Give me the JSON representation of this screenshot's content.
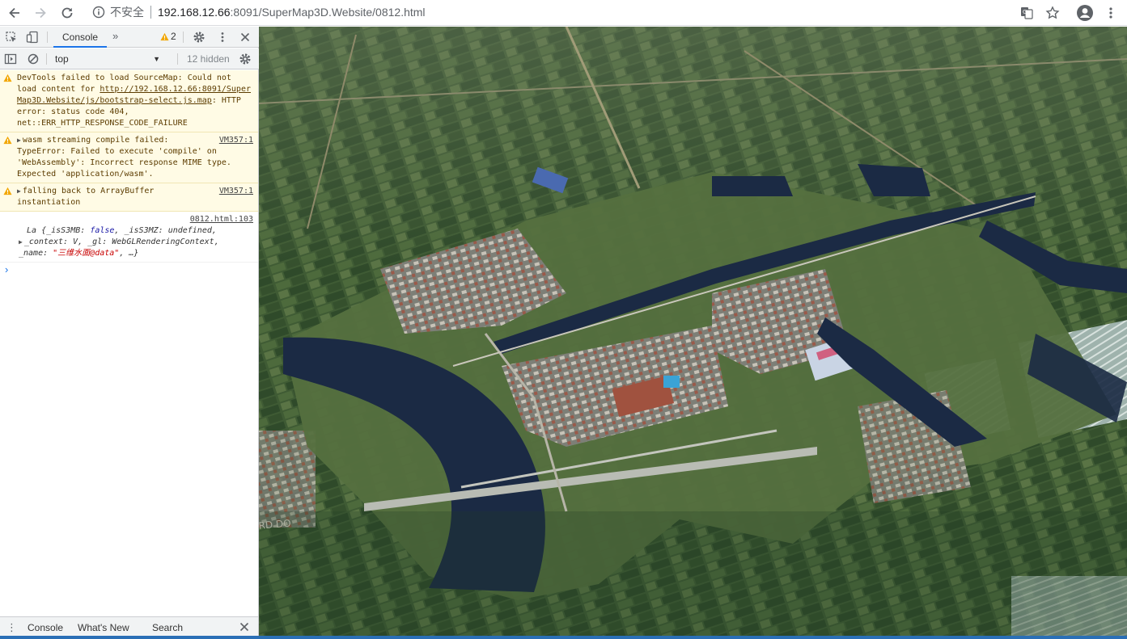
{
  "browser": {
    "security_label": "不安全",
    "url_host": "192.168.12.66",
    "url_path": ":8091/SuperMap3D.Website/0812.html"
  },
  "devtools": {
    "tab_console": "Console",
    "warning_count": "2",
    "context": "top",
    "hidden": "12 hidden",
    "messages": [
      {
        "level": "warning",
        "text_pre": "DevTools failed to load SourceMap: Could not load content for ",
        "link": "http://192.168.12.66:8091/SuperMap3D.Website/js/bootstrap-select.js.map",
        "text_post": ": HTTP error: status code 404, net::ERR_HTTP_RESPONSE_CODE_FAILURE"
      },
      {
        "level": "warning",
        "source": "VM357:1",
        "text": "wasm streaming compile failed: TypeError: Failed to execute 'compile' on 'WebAssembly': Incorrect response MIME type. Expected 'application/wasm'."
      },
      {
        "level": "warning",
        "source": "VM357:1",
        "text": "falling back to ArrayBuffer instantiation"
      },
      {
        "level": "log",
        "source": "0812.html:103",
        "obj_name": "La",
        "k1": "_isS3MB:",
        "v1": "false",
        "k2": "_isS3MZ:",
        "v2": "undefined",
        "k3": "_gl:",
        "v3": "WebGLRenderingContext",
        "k4": "_context:",
        "v4": "V",
        "k5": "_name:",
        "v5": "\"三维水面@data\"",
        "ellipsis": "…"
      }
    ],
    "drawer_tabs": [
      "Console",
      "What's New",
      "Search"
    ]
  },
  "map": {
    "road_marking": "RD DO"
  },
  "icons": [
    "back-icon",
    "forward-icon",
    "reload-icon",
    "info-icon",
    "translate-icon",
    "star-icon",
    "account-icon",
    "kebab-icon",
    "inspect-icon",
    "device-icon",
    "warning-icon",
    "gear-icon",
    "close-icon",
    "sidebar-icon",
    "clear-icon"
  ],
  "colors": {
    "accent": "#1a73e8",
    "warning_bg": "#fffbe5",
    "water": "#1b2a44"
  }
}
